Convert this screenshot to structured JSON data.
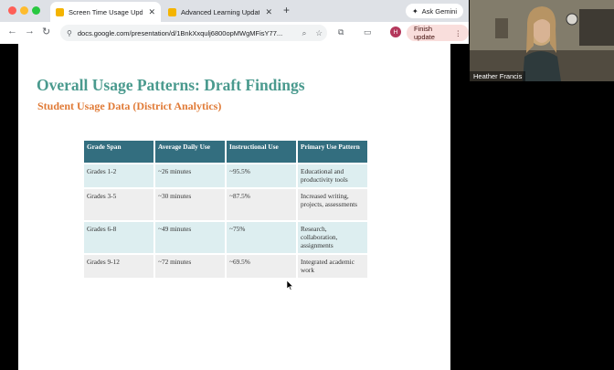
{
  "browser": {
    "tabs": [
      {
        "title": "Screen Time Usage Update",
        "active": true
      },
      {
        "title": "Advanced Learning Updates",
        "active": false
      }
    ],
    "new_tab_label": "+",
    "ask_label": "Ask Gemini",
    "url": "docs.google.com/presentation/d/1BnkXxqulj6800opMWgMFisY77...",
    "profile_initial": "H",
    "finish_update_label": "Finish update"
  },
  "slide": {
    "title": "Overall Usage Patterns: Draft Findings",
    "subtitle": "Student Usage Data (District Analytics)",
    "table": {
      "headers": [
        "Grade Span",
        "Average Daily Use",
        "Instructional Use",
        "Primary Use Pattern"
      ],
      "rows": [
        [
          "Grades 1-2",
          "~26 minutes",
          "~95.5%",
          "Educational and productivity tools"
        ],
        [
          "Grades 3-5",
          "~30 minutes",
          "~87.5%",
          "Increased writing, projects, assessments"
        ],
        [
          "Grades 6-8",
          "~49 minutes",
          "~75%",
          "Research, collaboration, assignments"
        ],
        [
          "Grades 9-12",
          "~72 minutes",
          "~69.5%",
          "Integrated academic work"
        ]
      ]
    }
  },
  "video": {
    "participant_name": "Heather Francis"
  },
  "colors": {
    "title": "#4a9a8e",
    "subtitle": "#e07a36",
    "table_header": "#336e7f",
    "row_tint": "#ddeef0",
    "row_gray": "#eeeeee"
  }
}
